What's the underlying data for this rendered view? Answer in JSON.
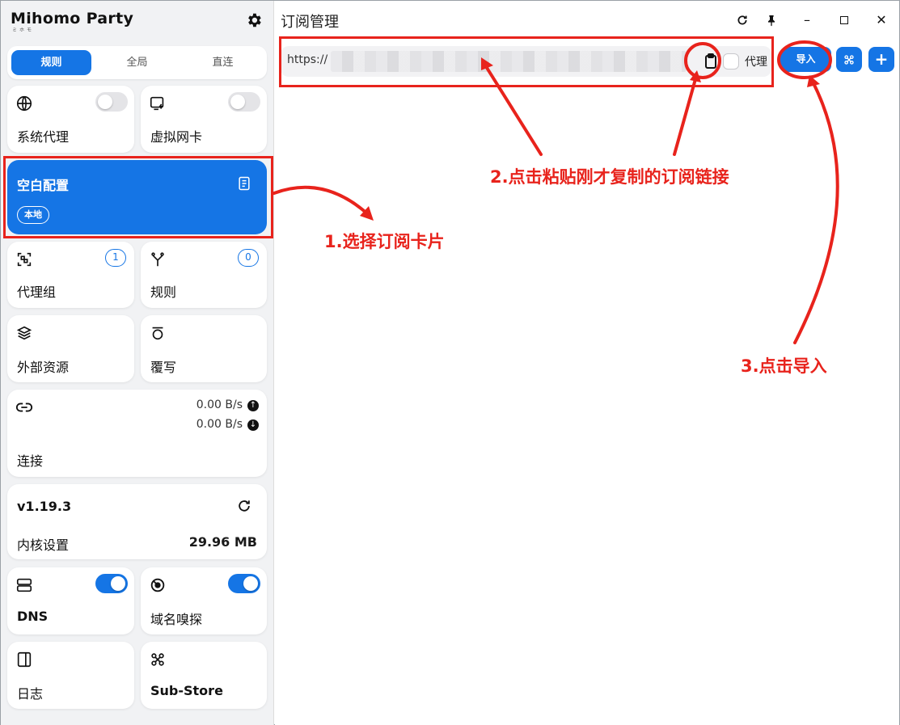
{
  "app": {
    "title": "Mihomo Party",
    "title_sub": "ミホモ"
  },
  "mode_tabs": [
    {
      "label": "规则",
      "active": true
    },
    {
      "label": "全局",
      "active": false
    },
    {
      "label": "直连",
      "active": false
    }
  ],
  "cards": {
    "system_proxy": {
      "label": "系统代理",
      "enabled": false
    },
    "tun": {
      "label": "虚拟网卡",
      "enabled": false
    },
    "profile": {
      "name": "空白配置",
      "chip": "本地"
    },
    "proxy_groups": {
      "label": "代理组",
      "count": "1"
    },
    "rules": {
      "label": "规则",
      "count": "0"
    },
    "resources": {
      "label": "外部资源"
    },
    "override": {
      "label": "覆写"
    },
    "connections": {
      "label": "连接",
      "upload": "0.00 B/s",
      "download": "0.00 B/s"
    },
    "core": {
      "version": "v1.19.3",
      "label": "内核设置",
      "memory": "29.96 MB"
    },
    "dns": {
      "label": "DNS",
      "enabled": true
    },
    "sniffer": {
      "label": "域名嗅探",
      "enabled": true
    },
    "log": {
      "label": "日志"
    },
    "substore": {
      "label": "Sub-Store"
    }
  },
  "main": {
    "title": "订阅管理",
    "url_value": "https://",
    "proxy_label": "代理",
    "import_label": "导入"
  },
  "annotations": {
    "step1": "1.选择订阅卡片",
    "step2": "2.点击粘贴刚才复制的订阅链接",
    "step3": "3.点击导入"
  },
  "colors": {
    "accent": "#1575e5",
    "annotation": "#e8231c"
  }
}
